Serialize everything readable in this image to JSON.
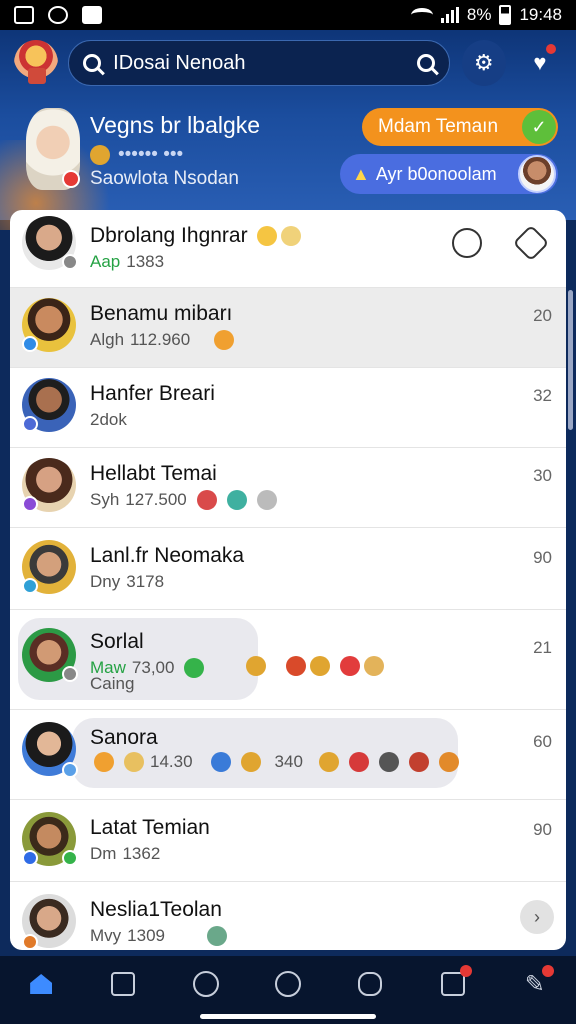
{
  "status_bar": {
    "battery": "8%",
    "time": "19:48"
  },
  "search": {
    "value": "IDosai Nenoah"
  },
  "profile": {
    "name": "Vegns br lbalgke",
    "subtitle": "•••••• •••",
    "status": "Saowlota Nsodan"
  },
  "actions": {
    "orange_pill": "Mdam Temaın",
    "blue_pill": "Ayr b0onoolam"
  },
  "list": [
    {
      "name": "Dbrolang Ihgnrar",
      "prefix": "Aap",
      "meta": "1383",
      "count": ""
    },
    {
      "name": "Benamu mibarı",
      "prefix": "Algh",
      "meta": "112.960",
      "count": "20"
    },
    {
      "name": "Hanfer Breari",
      "prefix": "2dok",
      "meta": "",
      "count": "32"
    },
    {
      "name": "Hellabt Temai",
      "prefix": "Syh",
      "meta": "127.500",
      "count": "30"
    },
    {
      "name": "Lanl.fr Neomaka",
      "prefix": "Dny",
      "meta": "3178",
      "count": "90"
    },
    {
      "name": "Sorlal",
      "prefix": "Maw",
      "meta": "73,00",
      "extra": "Caing",
      "count": "21"
    },
    {
      "name": "Sanora",
      "prefix": "",
      "meta": "14.30",
      "extra": "340",
      "count": "60"
    },
    {
      "name": "Latat Temian",
      "prefix": "Dm",
      "meta": "1362",
      "count": "90"
    },
    {
      "name": "Neslia1Teolan",
      "prefix": "Mvy",
      "meta": "1309",
      "count": ""
    }
  ],
  "icons": {
    "nav": [
      "home-icon",
      "book-icon",
      "search-icon",
      "clock-icon",
      "people-icon",
      "docs-icon",
      "edit-icon"
    ]
  },
  "colors": {
    "accent": "#3d8bff",
    "orange": "#f3921d",
    "pill_blue": "#4a6de0",
    "header": "#1b4d9e"
  }
}
